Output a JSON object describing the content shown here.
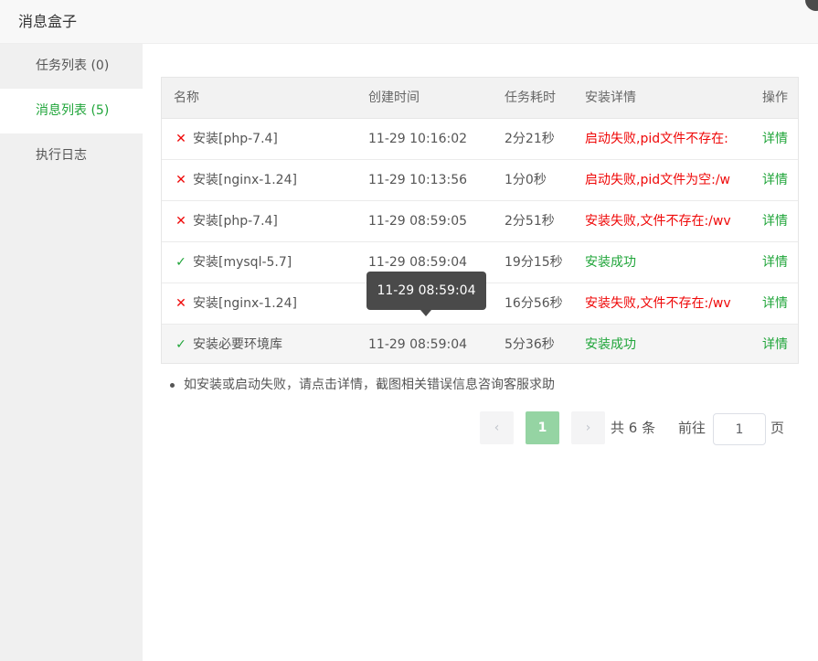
{
  "dialog": {
    "title": "消息盒子"
  },
  "sidebar": {
    "items": [
      {
        "label": "任务列表 (0)",
        "active": false
      },
      {
        "label": "消息列表 (5)",
        "active": true
      },
      {
        "label": "执行日志",
        "active": false
      }
    ]
  },
  "table": {
    "headers": {
      "name": "名称",
      "time": "创建时间",
      "duration": "任务耗时",
      "detail": "安装详情",
      "op": "操作"
    },
    "rows": [
      {
        "status": "fail",
        "icon": "close-icon",
        "name": "安装[php-7.4]",
        "time": "11-29 10:16:02",
        "duration": "2分21秒",
        "detail": "启动失败,pid文件不存在:",
        "op": "详情"
      },
      {
        "status": "fail",
        "icon": "close-icon",
        "name": "安装[nginx-1.24]",
        "time": "11-29 10:13:56",
        "duration": "1分0秒",
        "detail": "启动失败,pid文件为空:/w",
        "op": "详情"
      },
      {
        "status": "fail",
        "icon": "close-icon",
        "name": "安装[php-7.4]",
        "time": "11-29 08:59:05",
        "duration": "2分51秒",
        "detail": "安装失败,文件不存在:/wv",
        "op": "详情"
      },
      {
        "status": "ok",
        "icon": "check-icon",
        "name": "安装[mysql-5.7]",
        "time": "11-29 08:59:04",
        "duration": "19分15秒",
        "detail": "安装成功",
        "op": "详情"
      },
      {
        "status": "fail",
        "icon": "close-icon",
        "name": "安装[nginx-1.24]",
        "time": "",
        "duration": "16分56秒",
        "detail": "安装失败,文件不存在:/wv",
        "op": "详情"
      },
      {
        "status": "ok",
        "icon": "check-icon",
        "name": "安装必要环境库",
        "time": "11-29 08:59:04",
        "duration": "5分36秒",
        "detail": "安装成功",
        "op": "详情"
      }
    ]
  },
  "tooltip": {
    "text": "11-29 08:59:04"
  },
  "notes": [
    "如安装或启动失败，请点击详情，截图相关错误信息咨询客服求助"
  ],
  "pagination": {
    "prev_icon": "‹",
    "current_page": "1",
    "next_icon": "›",
    "total_text": "共 6 条",
    "goto_label": "前往",
    "goto_value": "1",
    "page_suffix": "页"
  },
  "colors": {
    "accent": "#20a53a",
    "error": "#ef0808"
  }
}
